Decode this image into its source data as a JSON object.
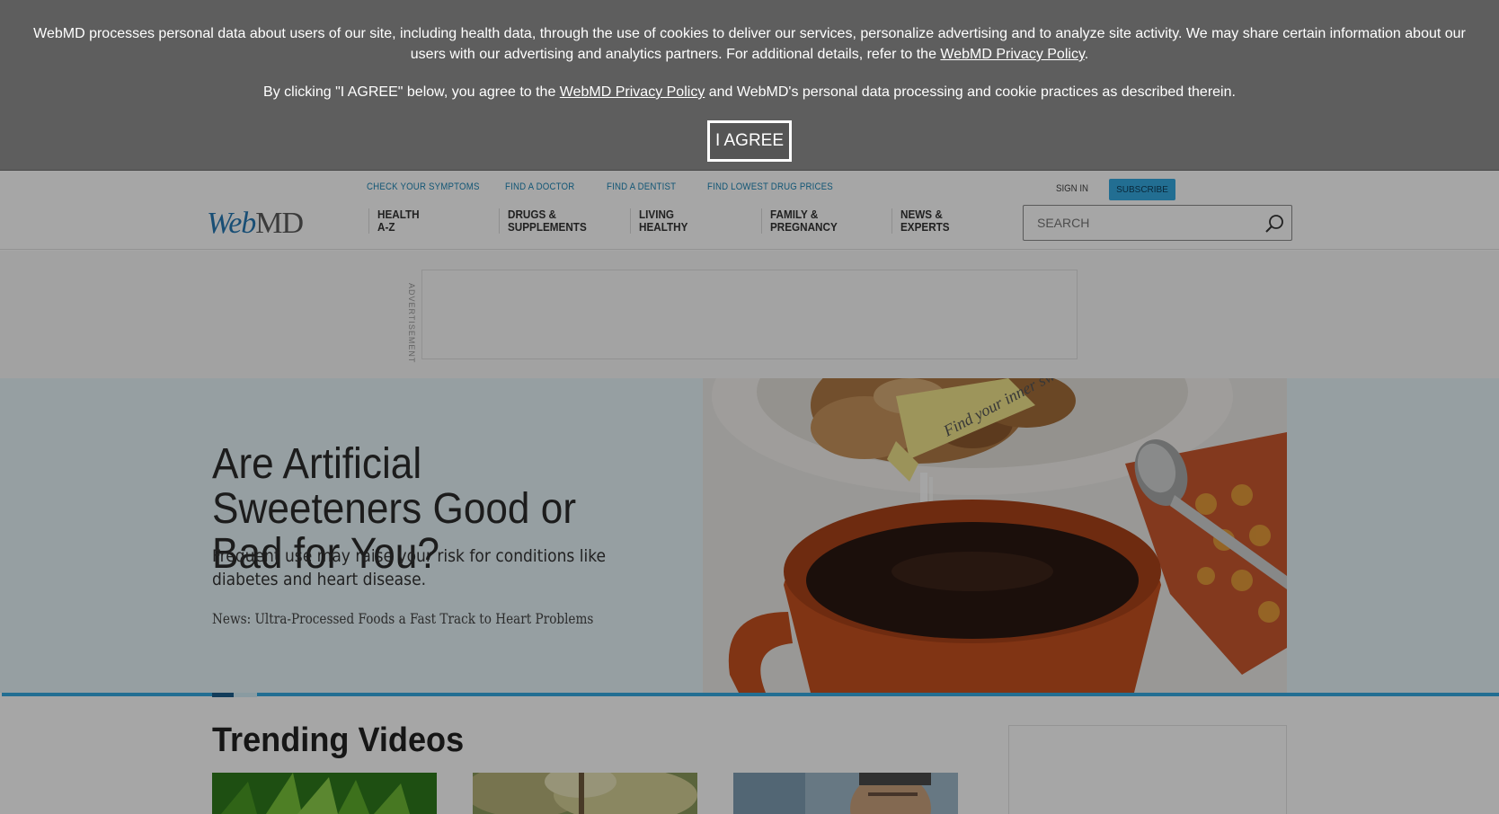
{
  "cookie_banner": {
    "paragraph1_text": "WebMD processes personal data about users of our site, including health data, through the use of cookies to deliver our services, personalize advertising and to analyze site activity. We may share certain information about our users with our advertising and analytics partners. For additional details, refer to the ",
    "paragraph1_link": "WebMD Privacy Policy",
    "paragraph1_end": ".",
    "paragraph2_start": "By clicking \"I AGREE\" below, you agree to the ",
    "paragraph2_link": "WebMD Privacy Policy",
    "paragraph2_end": " and WebMD's personal data processing and cookie practices as described therein.",
    "agree_label": "I AGREE"
  },
  "header": {
    "utility_links": [
      "CHECK YOUR SYMPTOMS",
      "FIND A DOCTOR",
      "FIND A DENTIST",
      "FIND LOWEST DRUG PRICES"
    ],
    "sign_in": "SIGN IN",
    "subscribe": "SUBSCRIBE",
    "logo_web": "Web",
    "logo_md": "MD",
    "nav": [
      "HEALTH\nA-Z",
      "DRUGS &\nSUPPLEMENTS",
      "LIVING\nHEALTHY",
      "FAMILY &\nPREGNANCY",
      "NEWS &\nEXPERTS"
    ],
    "search_placeholder": "SEARCH"
  },
  "ad": {
    "label": "ADVERTISEMENT"
  },
  "hero": {
    "title": "Are Artificial Sweeteners Good or Bad for You?",
    "subtitle": "Frequent use may raise your risk for conditions like diabetes and heart disease.",
    "news": "News: Ultra-Processed Foods a Fast Track to Heart Problems",
    "image_packet_text": "Find your inner sweetness",
    "carousel_position": 1
  },
  "trending": {
    "title": "Trending Videos",
    "thumbnails": [
      "cannabis-leaf",
      "blurred-trees",
      "man-portrait"
    ]
  },
  "colors": {
    "banner_bg": "#5e5e5e",
    "accent_blue": "#35a9e0",
    "link_blue": "#1f86b5",
    "hero_bg": "#e6f4f9"
  }
}
